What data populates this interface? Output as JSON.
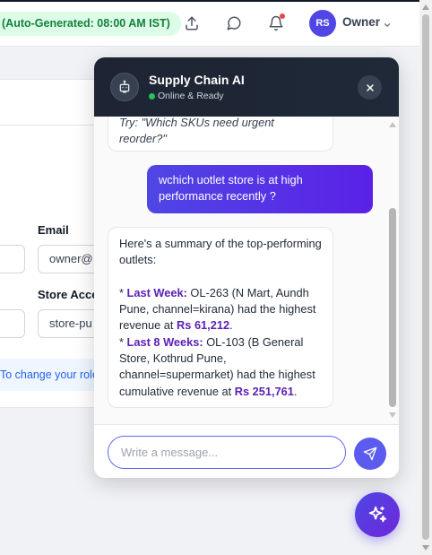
{
  "topbar": {
    "autogen_label": "(Auto-Generated: 08:00 AM IST)",
    "avatar_initials": "RS",
    "user_name": "Owner",
    "icons": [
      "upload-icon",
      "chat-icon",
      "bell-icon",
      "chevron-down-icon"
    ]
  },
  "form": {
    "email_label": "Email",
    "email_value": "owner@",
    "store_access_label": "Store Acce",
    "store_access_value": "store-pu",
    "info_text": "To change your role"
  },
  "chat": {
    "title": "Supply Chain AI",
    "status": "Online & Ready",
    "prev_message": "Try: \"Which SKUs need urgent reorder?\"",
    "user_message": "wchich uotlet store is at high performance recently ?",
    "reply": {
      "intro": "Here's a summary of the top-performing outlets:",
      "lw_label": "Last Week:",
      "lw_text": " OL-263 (N Mart, Aundh Pune, channel=kirana) had the highest revenue at ",
      "lw_value": "Rs 61,212",
      "l8_label": "Last 8 Weeks:",
      "l8_text": " OL-103 (B General Store, Kothrud Pune, channel=supermarket) had the highest cumulative revenue at ",
      "l8_value": "Rs 251,761"
    },
    "input_placeholder": "Write a message...",
    "status_color": "#22c55e",
    "accent_color": "#4f46e5"
  }
}
